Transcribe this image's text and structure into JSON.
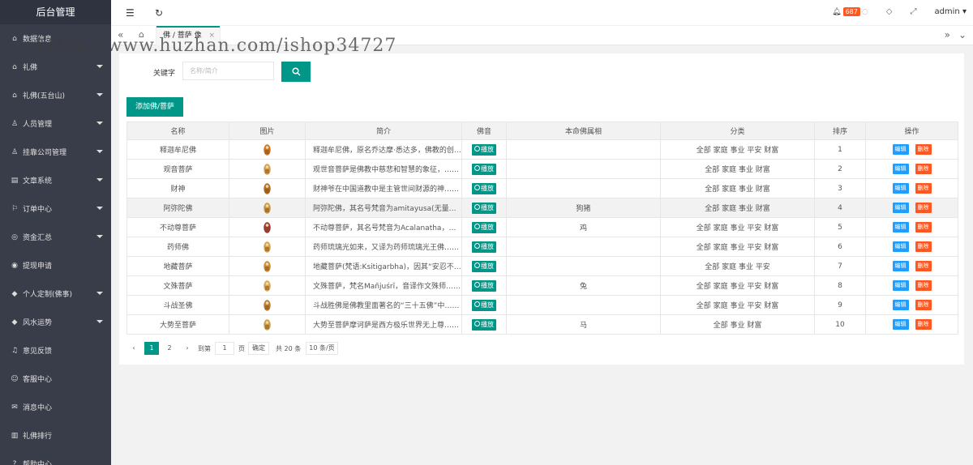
{
  "sidebar": {
    "logo": "后台管理",
    "items": [
      {
        "icon": "home-icon",
        "glyph": "⌂",
        "label": "数据信息",
        "arrow": false
      },
      {
        "icon": "temple-icon",
        "glyph": "⌂",
        "label": "礼佛",
        "arrow": true
      },
      {
        "icon": "temple-icon",
        "glyph": "⌂",
        "label": "礼佛(五台山)",
        "arrow": true
      },
      {
        "icon": "user-icon",
        "glyph": "♙",
        "label": "人员管理",
        "arrow": true
      },
      {
        "icon": "user-icon",
        "glyph": "♙",
        "label": "挂靠公司管理",
        "arrow": true
      },
      {
        "icon": "document-icon",
        "glyph": "▤",
        "label": "文章系统",
        "arrow": true
      },
      {
        "icon": "flag-icon",
        "glyph": "⚐",
        "label": "订单中心",
        "arrow": true
      },
      {
        "icon": "coin-icon",
        "glyph": "◎",
        "label": "资金汇总",
        "arrow": true
      },
      {
        "icon": "withdraw-icon",
        "glyph": "◉",
        "label": "提现申请",
        "arrow": false
      },
      {
        "icon": "diamond-icon",
        "glyph": "◆",
        "label": "个人定制(佛事)",
        "arrow": true
      },
      {
        "icon": "diamond-icon",
        "glyph": "◆",
        "label": "风水运势",
        "arrow": true
      },
      {
        "icon": "bell-icon",
        "glyph": "♫",
        "label": "意见反馈",
        "arrow": false
      },
      {
        "icon": "service-icon",
        "glyph": "☺",
        "label": "客服中心",
        "arrow": false
      },
      {
        "icon": "message-icon",
        "glyph": "✉",
        "label": "消息中心",
        "arrow": false
      },
      {
        "icon": "ranking-icon",
        "glyph": "▥",
        "label": "礼佛排行",
        "arrow": false
      },
      {
        "icon": "help-icon",
        "glyph": "?",
        "label": "帮助中心",
        "arrow": false
      }
    ]
  },
  "header": {
    "notify_count": "687",
    "user": "admin"
  },
  "tabs": {
    "active_label": "佛 / 菩萨 像",
    "close": "×"
  },
  "search": {
    "label": "关键字",
    "placeholder": "名称/简介"
  },
  "add_button": "添加佛/菩萨",
  "table": {
    "columns": [
      "名称",
      "图片",
      "简介",
      "佛音",
      "本命佛属相",
      "分类",
      "排序",
      "操作"
    ],
    "play_label": "播放",
    "edit_label": "编辑",
    "delete_label": "删除",
    "rows": [
      {
        "name": "释迦牟尼佛",
        "intro": "释迦牟尼佛，原名乔达摩·悉达多，佛教的创始人……",
        "zodiac": "",
        "category": "全部 家庭 事业 平安 财富",
        "order": "1",
        "color": "#c8782c"
      },
      {
        "name": "观音菩萨",
        "intro": "观世音菩萨是佛教中慈悲和智慧的象征，……",
        "zodiac": "",
        "category": "全部 家庭 事业 财富",
        "order": "2",
        "color": "#d3a055"
      },
      {
        "name": "财神",
        "intro": "财神爷在中国道教中是主管世间财源的神……",
        "zodiac": "",
        "category": "全部 家庭 事业 财富",
        "order": "3",
        "color": "#b0702a"
      },
      {
        "name": "阿弥陀佛",
        "intro": "阿弥陀佛，其名号梵音为amitayusa(无量……",
        "zodiac": "狗猪",
        "category": "全部 家庭 事业 财富",
        "order": "4",
        "color": "#c89a48"
      },
      {
        "name": "不动尊菩萨",
        "intro": "不动尊菩萨，其名号梵音为Acalanatha，……",
        "zodiac": "鸡",
        "category": "全部 家庭 事业 平安 财富",
        "order": "5",
        "color": "#9a3a3a"
      },
      {
        "name": "药师佛",
        "intro": "药师琉璃光如来，又译为药师琉璃光王佛……",
        "zodiac": "",
        "category": "全部 家庭 事业 平安 财富",
        "order": "6",
        "color": "#d4a24a"
      },
      {
        "name": "地藏菩萨",
        "intro": "地藏菩萨(梵语:Ksitigarbha)，因其“安忍不……",
        "zodiac": "",
        "category": "全部 家庭 事业 平安",
        "order": "7",
        "color": "#c6903c"
      },
      {
        "name": "文殊菩萨",
        "intro": "文殊菩萨，梵名Mañjuśrī，音译作文殊师……",
        "zodiac": "兔",
        "category": "全部 家庭 事业 平安 财富",
        "order": "8",
        "color": "#d6a95a"
      },
      {
        "name": "斗战圣佛",
        "intro": "斗战胜佛是佛教里面著名的“三十五佛”中……",
        "zodiac": "",
        "category": "全部 家庭 事业 平安 财富",
        "order": "9",
        "color": "#b8823a"
      },
      {
        "name": "大势至菩萨",
        "intro": "大势至菩萨摩诃萨是西方极乐世界无上尊……",
        "zodiac": "马",
        "category": "全部 事业 财富",
        "order": "10",
        "color": "#caa050"
      }
    ]
  },
  "pager": {
    "prev": "‹",
    "pages": [
      "1",
      "2"
    ],
    "next": "›",
    "goto_label": "到第",
    "goto_value": "1",
    "page_unit": "页",
    "confirm": "确定",
    "total": "共 20 条",
    "size": "10 条/页"
  },
  "watermark": "https://www.huzhan.com/ishop34727"
}
